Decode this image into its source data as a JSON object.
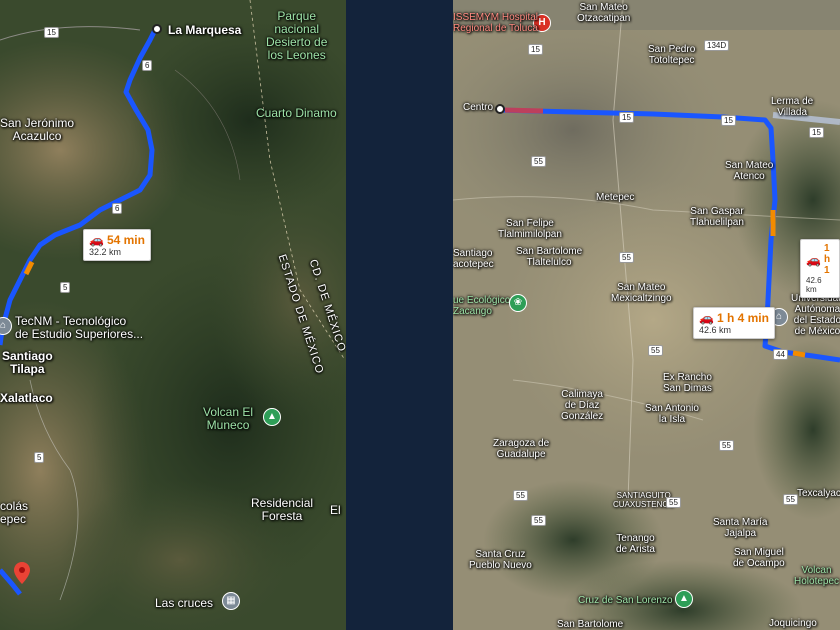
{
  "left_map": {
    "places": {
      "la_marquesa": "La Marquesa",
      "parque": "Parque\nnacional\nDesierto de\nlos Leones",
      "cuarto_dinamo": "Cuarto Dinamo",
      "san_jeronimo": "San Jerónimo\nAcazulco",
      "estado_de_mexico": "ESTADO DE MÉXICO",
      "cd_de_mexico": "CD. DE MÉXICO",
      "tecnm": "TecNM - Tecnológico\nde Estudio Superiores...",
      "santiago_tilapa": "Santiago\nTilapa",
      "xalatlaco": "Xalatlaco",
      "volcan_muneco": "Volcan El\nMuneco",
      "colas": "colás\nepec",
      "residencial": "Residencial\nForesta",
      "el": "El",
      "las_cruces": "Las cruces"
    },
    "shields": [
      "15",
      "6",
      "6",
      "5",
      "5"
    ],
    "route": {
      "time": "54 min",
      "distance": "32.2 km"
    }
  },
  "right_map": {
    "places": {
      "hospital": "ISSEMYM Hospital\nRegional de Toluca",
      "san_mateo_otz": "San Mateo\nOtzacatipan",
      "san_pedro": "San Pedro\nTotoltepec",
      "centro": "Centro",
      "lerma": "Lerma de\nVillada",
      "san_mateo_atenco": "San Mateo\nAtenco",
      "metepec": "Metepec",
      "san_gaspar": "San Gaspar\nTlahuelilpan",
      "san_felipe": "San Felipe\nTlalmimilolpan",
      "santiago": "Santiago\nacotepec",
      "san_bartolome_t": "San Bartolome\nTlaltelulco",
      "zacango": "ue Ecológico\nZacango",
      "mexicaltzingo": "San Mateo\nMexicaltzingo",
      "universidad": "Universidad\nAutónoma\ndel Estado\nde México",
      "calimaya": "Calimaya\nde Díaz\nGonzález",
      "ex_rancho": "Ex Rancho\nSan Dimas",
      "san_antonio": "San Antonio\nla Isla",
      "zaragoza": "Zaragoza de\nGuadalupe",
      "santiaguito": "SANTIAGUITO\nCUAXUSTENCO",
      "texcalyac": "Texcalyac",
      "santa_maria": "Santa María\nJajalpa",
      "tenango": "Tenango\nde Arista",
      "san_miguel": "San Miguel\nde Ocampo",
      "volcan_holo": "Volcan\nHolotepec",
      "santa_cruz": "Santa Cruz\nPueblo Nuevo",
      "cruz_san_lorenzo": "Cruz de San Lorenzo",
      "san_bartolome": "San Bartolome",
      "joquicingo": "Joquicingo"
    },
    "shields": [
      "15",
      "134D",
      "15",
      "15",
      "15",
      "55",
      "55",
      "55",
      "44",
      "55",
      "55",
      "55",
      "55",
      "55"
    ],
    "route_main": {
      "time": "1 h 4 min",
      "distance": "42.6 km"
    },
    "route_alt": {
      "time": "1 h 1",
      "distance": "42.6 km"
    }
  }
}
